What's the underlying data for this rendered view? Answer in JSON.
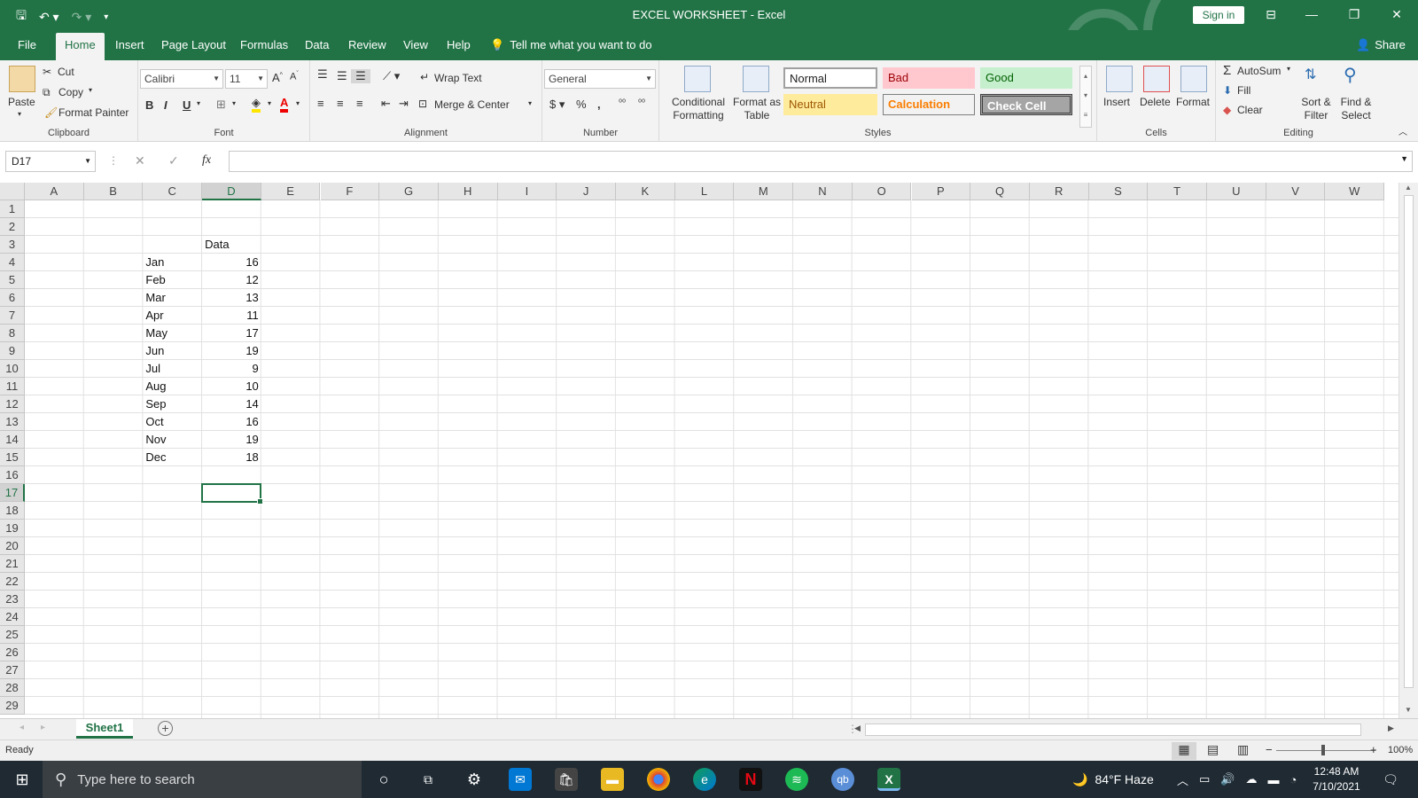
{
  "app": {
    "window_title": "EXCEL WORKSHEET  -  Excel",
    "sign_in": "Sign in",
    "share": "Share"
  },
  "tabs": [
    "File",
    "Home",
    "Insert",
    "Page Layout",
    "Formulas",
    "Data",
    "Review",
    "View",
    "Help"
  ],
  "tell_me": "Tell me what you want to do",
  "ribbon": {
    "clipboard": {
      "paste": "Paste",
      "cut": "Cut",
      "copy": "Copy",
      "format_painter": "Format Painter",
      "label": "Clipboard"
    },
    "font": {
      "name": "Calibri",
      "size": "11",
      "label": "Font"
    },
    "alignment": {
      "wrap_text": "Wrap Text",
      "merge_center": "Merge & Center",
      "label": "Alignment"
    },
    "number": {
      "format": "General",
      "label": "Number"
    },
    "styles": {
      "conditional": "Conditional Formatting",
      "format_as_table": "Format as Table",
      "normal": "Normal",
      "bad": "Bad",
      "good": "Good",
      "neutral": "Neutral",
      "calculation": "Calculation",
      "check_cell": "Check Cell",
      "label": "Styles"
    },
    "cells": {
      "insert": "Insert",
      "delete": "Delete",
      "format": "Format",
      "label": "Cells"
    },
    "editing": {
      "autosum": "AutoSum",
      "fill": "Fill",
      "clear": "Clear",
      "sort_filter": "Sort & Filter",
      "find_select": "Find & Select",
      "label": "Editing"
    }
  },
  "formula_bar": {
    "name_box": "D17",
    "fx": "fx",
    "value": ""
  },
  "columns": [
    "A",
    "B",
    "C",
    "D",
    "E",
    "F",
    "G",
    "H",
    "I",
    "J",
    "K",
    "L",
    "M",
    "N",
    "O",
    "P",
    "Q",
    "R",
    "S",
    "T",
    "U",
    "V",
    "W"
  ],
  "rows": [
    "1",
    "2",
    "3",
    "4",
    "5",
    "6",
    "7",
    "8",
    "9",
    "10",
    "11",
    "12",
    "13",
    "14",
    "15",
    "16",
    "17",
    "18",
    "19",
    "20",
    "21",
    "22",
    "23",
    "24",
    "25",
    "26",
    "27",
    "28",
    "29"
  ],
  "sheet": {
    "header": "Data",
    "months": [
      "Jan",
      "Feb",
      "Mar",
      "Apr",
      "May",
      "Jun",
      "Jul",
      "Aug",
      "Sep",
      "Oct",
      "Nov",
      "Dec"
    ],
    "values": [
      "16",
      "12",
      "13",
      "11",
      "17",
      "19",
      "9",
      "10",
      "14",
      "16",
      "19",
      "18"
    ]
  },
  "sheet_tab": "Sheet1",
  "status": {
    "ready": "Ready",
    "zoom": "100%"
  },
  "taskbar": {
    "search": "Type here to search",
    "weather": "84°F  Haze",
    "time": "12:48 AM",
    "date": "7/10/2021"
  },
  "colors": {
    "accent": "#217346",
    "bad_bg": "#ffc7ce",
    "good_bg": "#c6efce",
    "neutral_bg": "#ffeb9c",
    "calc_text": "#fa7d00"
  }
}
